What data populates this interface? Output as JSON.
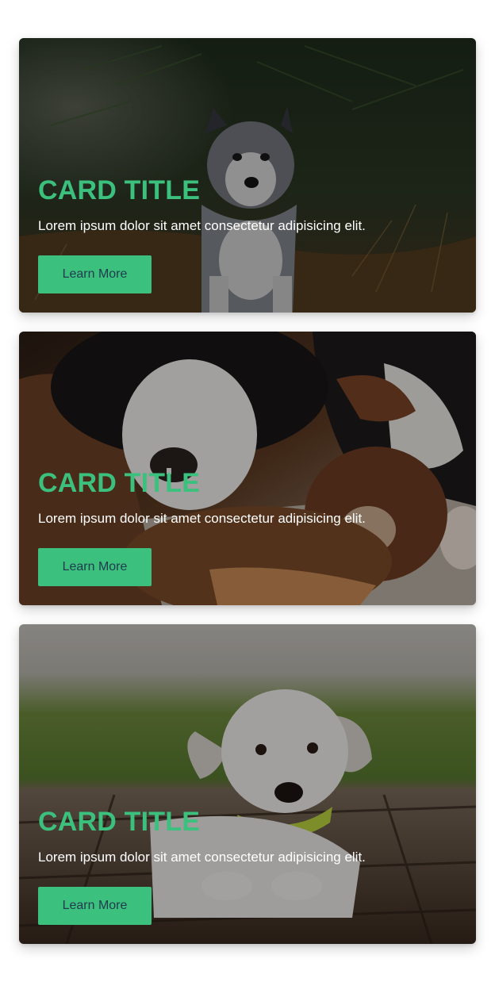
{
  "theme": {
    "accent": "#3cc07e",
    "button_text": "#1f3b4d",
    "overlay": "rgba(0,0,0,0.45)"
  },
  "cards": [
    {
      "title": "CARD TITLE",
      "text": "Lorem ipsum dolor sit amet consectetur adipisicing elit.",
      "button_label": "Learn More",
      "image": "husky-puppy-in-forest"
    },
    {
      "title": "CARD TITLE",
      "text": "Lorem ipsum dolor sit amet consectetur adipisicing elit.",
      "button_label": "Learn More",
      "image": "two-puppies-lying-together"
    },
    {
      "title": "CARD TITLE",
      "text": "Lorem ipsum dolor sit amet consectetur adipisicing elit.",
      "button_label": "Learn More",
      "image": "white-puppy-on-wooden-deck"
    }
  ]
}
